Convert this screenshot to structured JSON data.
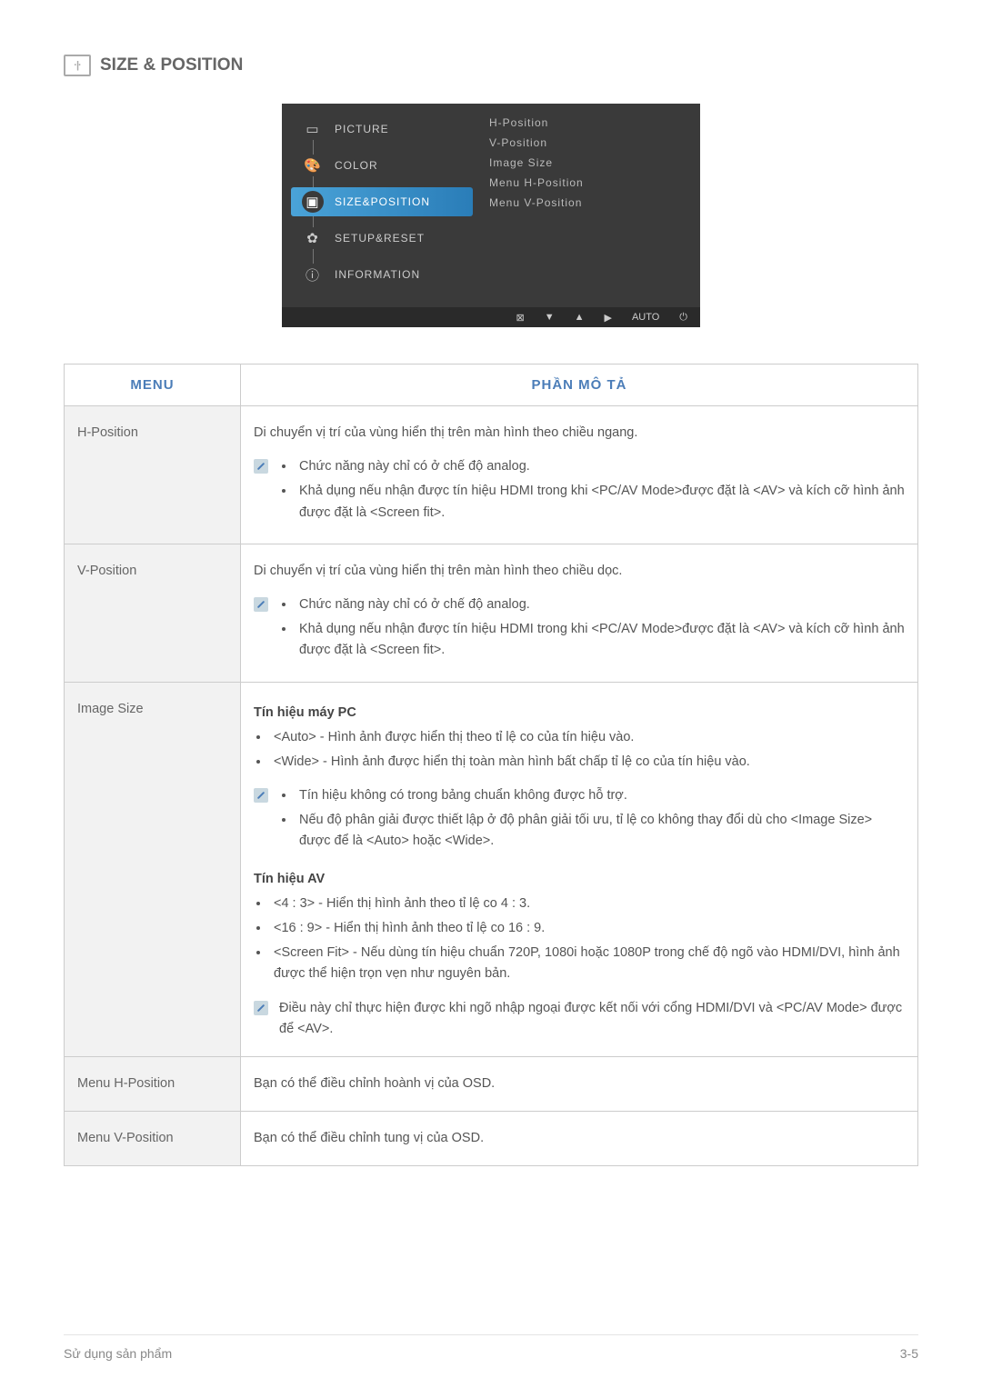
{
  "section": {
    "title": "SIZE & POSITION"
  },
  "osd": {
    "left": [
      {
        "label": "PICTURE",
        "icon": "▭"
      },
      {
        "label": "COLOR",
        "icon": "🎨"
      },
      {
        "label": "SIZE&POSITION",
        "icon": "▣"
      },
      {
        "label": "SETUP&RESET",
        "icon": "✿"
      },
      {
        "label": "INFORMATION",
        "icon": "ⓘ"
      }
    ],
    "right": [
      "H-Position",
      "V-Position",
      "Image Size",
      "Menu H-Position",
      "Menu V-Position"
    ],
    "footer_auto": "AUTO"
  },
  "table": {
    "header_menu": "MENU",
    "header_desc": "PHẦN MÔ TẢ",
    "rows": {
      "hpos": {
        "menu": "H-Position",
        "intro": "Di chuyển vị trí của vùng hiển thị trên màn hình theo chiều ngang.",
        "note1": "Chức năng này chỉ có ở chế độ analog.",
        "note2": "Khả dụng nếu nhận được tín hiệu HDMI trong khi <PC/AV Mode>được đặt là <AV> và kích cỡ hình ảnh được đặt là <Screen fit>."
      },
      "vpos": {
        "menu": "V-Position",
        "intro": "Di chuyển vị trí của vùng hiển thị trên màn hình theo chiều dọc.",
        "note1": "Chức năng này chỉ có ở chế độ analog.",
        "note2": "Khả dụng nếu nhận được tín hiệu HDMI trong khi <PC/AV Mode>được đặt là <AV> và kích cỡ hình ảnh được đặt là <Screen fit>."
      },
      "imagesize": {
        "menu": "Image Size",
        "pc_heading": "Tín hiệu máy PC",
        "pc_b1": "<Auto> - Hình ảnh được hiển thị theo tỉ lệ co của tín hiệu vào.",
        "pc_b2": "<Wide> - Hình ảnh được hiển thị toàn màn hình bất chấp tỉ lệ co của tín hiệu vào.",
        "pc_note1": "Tín hiệu không có trong bảng chuẩn không được hỗ trợ.",
        "pc_note2": "Nếu độ phân giải được thiết lập ở độ phân giải tối ưu, tỉ lệ co không thay đổi dù cho <Image Size> được để là <Auto> hoặc <Wide>.",
        "av_heading": "Tín hiệu AV",
        "av_b1": "<4 : 3> - Hiển thị hình ảnh theo tỉ lệ co 4 : 3.",
        "av_b2": "<16 : 9> - Hiển thị hình ảnh theo tỉ lệ co 16 : 9.",
        "av_b3": "<Screen Fit> - Nếu dùng tín hiệu chuẩn 720P, 1080i hoặc 1080P trong chế độ ngõ vào HDMI/DVI, hình ảnh được thể hiện trọn vẹn như nguyên bản.",
        "av_note": "Điều này chỉ thực hiện được khi ngõ nhập ngoại được kết nối với cổng HDMI/DVI và <PC/AV Mode> được để <AV>."
      },
      "menuh": {
        "menu": "Menu H-Position",
        "desc": "Bạn có thể điều chỉnh hoành vị của OSD."
      },
      "menuv": {
        "menu": "Menu V-Position",
        "desc": "Bạn có thể điều chỉnh tung vị của OSD."
      }
    }
  },
  "footer": {
    "left": "Sử dụng sản phẩm",
    "right": "3-5"
  }
}
